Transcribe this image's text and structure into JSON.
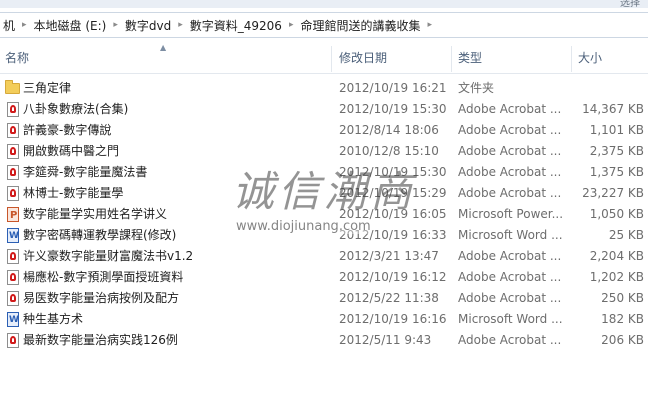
{
  "top_strip": {
    "left_caption": "",
    "right_caption": "选择"
  },
  "breadcrumb": [
    {
      "label": "机"
    },
    {
      "label": "本地磁盘 (E:)"
    },
    {
      "label": "數字dvd"
    },
    {
      "label": "數字資料_49206"
    },
    {
      "label": "命理館問送的講義收集"
    }
  ],
  "columns": {
    "name": "名称",
    "date": "修改日期",
    "type": "类型",
    "size": "大小"
  },
  "files": [
    {
      "icon": "folder-icon",
      "name": "三角定律",
      "date": "2012/10/19 16:21",
      "type": "文件夹",
      "size": ""
    },
    {
      "icon": "pdf-icon",
      "name": "八卦象數療法(合集)",
      "date": "2012/10/19 15:30",
      "type": "Adobe Acrobat ...",
      "size": "14,367 KB"
    },
    {
      "icon": "pdf-icon",
      "name": "許義豪-數字傳說",
      "date": "2012/8/14 18:06",
      "type": "Adobe Acrobat ...",
      "size": "1,101 KB"
    },
    {
      "icon": "pdf-icon",
      "name": "開啟數碼中醫之門",
      "date": "2010/12/8 15:10",
      "type": "Adobe Acrobat ...",
      "size": "2,375 KB"
    },
    {
      "icon": "pdf-icon",
      "name": "李筵舜-數字能量魔法書",
      "date": "2012/10/19 15:30",
      "type": "Adobe Acrobat ...",
      "size": "1,375 KB"
    },
    {
      "icon": "pdf-icon",
      "name": "林博士-數字能量學",
      "date": "2012/10/19 15:29",
      "type": "Adobe Acrobat ...",
      "size": "23,227 KB"
    },
    {
      "icon": "ppt-icon",
      "name": "数字能量学实用姓名学讲义",
      "date": "2012/10/19 16:05",
      "type": "Microsoft Power...",
      "size": "1,050 KB"
    },
    {
      "icon": "doc-icon",
      "name": "數字密碼轉運教學課程(修改)",
      "date": "2012/10/19 16:33",
      "type": "Microsoft Word ...",
      "size": "25 KB"
    },
    {
      "icon": "pdf-icon",
      "name": "许义豪数字能量财富魔法书v1.2",
      "date": "2012/3/21 13:47",
      "type": "Adobe Acrobat ...",
      "size": "2,204 KB"
    },
    {
      "icon": "pdf-icon",
      "name": "楊應松-數字預測學面授班資料",
      "date": "2012/10/19 16:12",
      "type": "Adobe Acrobat ...",
      "size": "1,202 KB"
    },
    {
      "icon": "pdf-icon",
      "name": "易医数字能量治病按例及配方",
      "date": "2012/5/22 11:38",
      "type": "Adobe Acrobat ...",
      "size": "250 KB"
    },
    {
      "icon": "doc-icon",
      "name": "种生基方术",
      "date": "2012/10/19 16:16",
      "type": "Microsoft Word ...",
      "size": "182 KB"
    },
    {
      "icon": "pdf-icon",
      "name": "最新数字能量治病实践126例",
      "date": "2012/5/11 9:43",
      "type": "Adobe Acrobat ...",
      "size": "206 KB"
    }
  ],
  "watermark": {
    "logo_text": "诚信潮商",
    "url": "www.diojiunang.com"
  }
}
